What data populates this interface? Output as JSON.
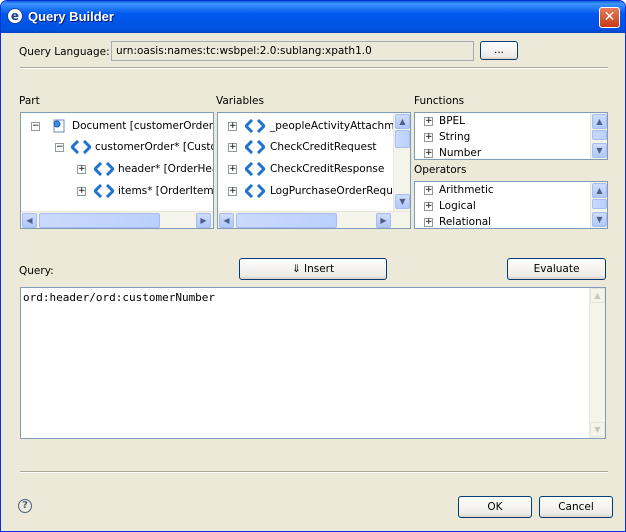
{
  "window": {
    "title": "Query Builder"
  },
  "query_language": {
    "label": "Query Language:",
    "value": "urn:oasis:names:tc:wsbpel:2.0:sublang:xpath1.0",
    "browse_label": "..."
  },
  "part": {
    "label": "Part",
    "items": [
      {
        "text": "Document [customerOrder]",
        "icon": "document-icon",
        "expander": "−"
      },
      {
        "text": "customerOrder* [Custon",
        "icon": "element-icon",
        "expander": "−"
      },
      {
        "text": "header* [OrderHea",
        "icon": "element-icon",
        "expander": "+"
      },
      {
        "text": "items* [OrderItems",
        "icon": "element-icon",
        "expander": "+"
      }
    ]
  },
  "variables": {
    "label": "Variables",
    "items": [
      {
        "text": "_peopleActivityAttachmen",
        "icon": "variable-icon",
        "expander": "+"
      },
      {
        "text": "CheckCreditRequest",
        "icon": "variable-icon",
        "expander": "+"
      },
      {
        "text": "CheckCreditResponse",
        "icon": "variable-icon",
        "expander": "+"
      },
      {
        "text": "LogPurchaseOrderReques",
        "icon": "variable-icon",
        "expander": "+"
      }
    ]
  },
  "functions": {
    "label": "Functions",
    "items": [
      "BPEL",
      "String",
      "Number"
    ]
  },
  "operators": {
    "label": "Operators",
    "items": [
      "Arithmetic",
      "Logical",
      "Relational"
    ]
  },
  "query": {
    "label": "Query:",
    "insert_label": "⇓ Insert",
    "evaluate_label": "Evaluate",
    "text": "ord:header/ord:customerNumber"
  },
  "footer": {
    "help_icon": "?",
    "ok_label": "OK",
    "cancel_label": "Cancel"
  },
  "colors": {
    "title_bar": "#0058ee",
    "dialog_bg": "#ece9d8",
    "icon_blue": "#1e73d2",
    "panel_border": "#7f9db9"
  }
}
